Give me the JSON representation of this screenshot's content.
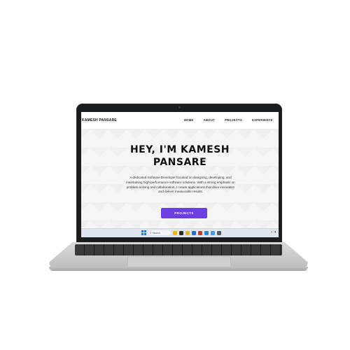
{
  "site": {
    "brand": "KAMESH PANSARE",
    "nav": [
      "HOME",
      "ABOUT",
      "PROJECTS",
      "EXPERIENCE"
    ],
    "hero": {
      "title_line1": "HEY, I'M KAMESH",
      "title_line2": "PANSARE",
      "description": "A dedicated Software Developer focused on designing, developing, and maintaining high-performance software solutions. With a strong emphasis on problem-solving and collaboration, I create applications that drive innovation and deliver measurable results.",
      "cta": "PROJECTS"
    }
  },
  "taskbar": {
    "search_label": "Search",
    "apps": [
      {
        "icon": "app-icon",
        "color": "#f2b705"
      },
      {
        "icon": "app-icon",
        "color": "#2b2b2b"
      },
      {
        "icon": "app-icon",
        "color": "#e7b336"
      },
      {
        "icon": "app-icon",
        "color": "#1f6fd1"
      },
      {
        "icon": "app-icon",
        "color": "#c23a2e"
      },
      {
        "icon": "app-icon",
        "color": "#2b88d8"
      },
      {
        "icon": "app-icon",
        "color": "#3aa0e8"
      },
      {
        "icon": "app-icon",
        "color": "#5a5a5a"
      }
    ]
  },
  "colors": {
    "accent": "#6d3fe0",
    "laptop_body": "#d0d0d3",
    "bezel": "#1b1c1e"
  }
}
